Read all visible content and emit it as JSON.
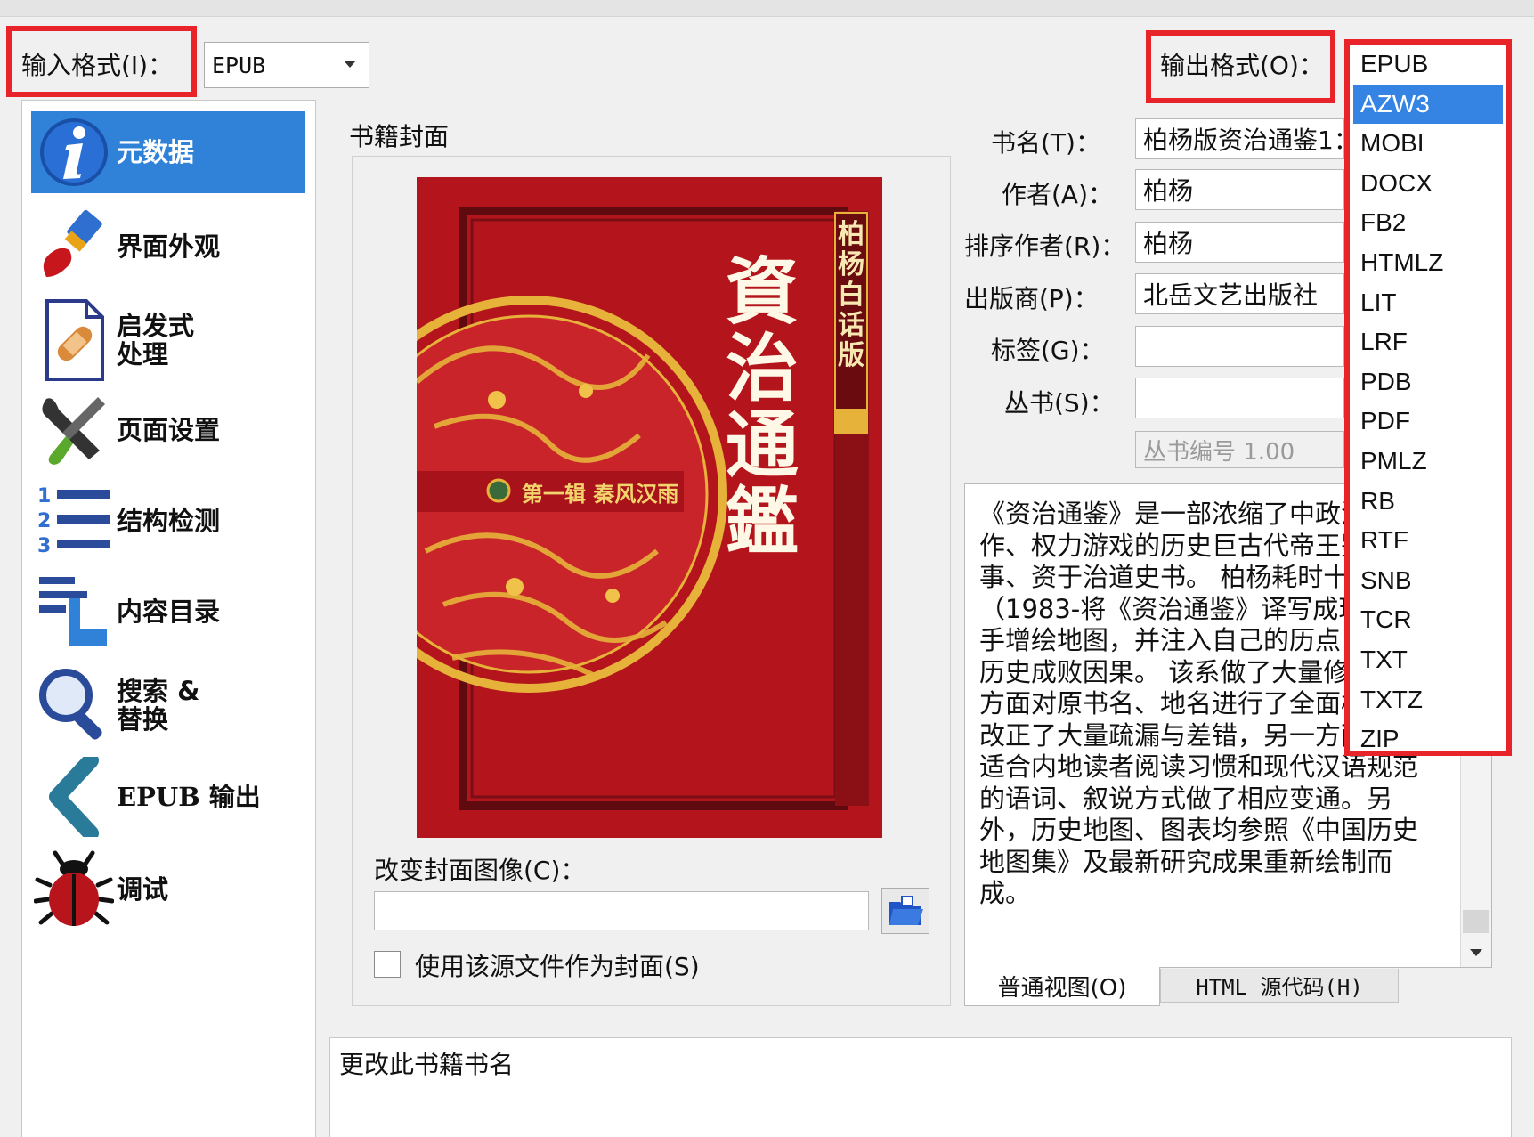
{
  "input_format": {
    "label": "输入格式(I)：",
    "value": "EPUB"
  },
  "output_format": {
    "label": "输出格式(O)：",
    "options": [
      "EPUB",
      "AZW3",
      "MOBI",
      "DOCX",
      "FB2",
      "HTMLZ",
      "LIT",
      "LRF",
      "PDB",
      "PDF",
      "PMLZ",
      "RB",
      "RTF",
      "SNB",
      "TCR",
      "TXT",
      "TXTZ",
      "ZIP"
    ],
    "selected": "AZW3"
  },
  "sidebar": {
    "items": [
      {
        "label": "元数据",
        "icon": "info-icon",
        "selected": true
      },
      {
        "label": "界面外观",
        "icon": "paintbrush-icon"
      },
      {
        "label": "启发式\n处理",
        "icon": "bandage-icon"
      },
      {
        "label": "页面设置",
        "icon": "tools-icon"
      },
      {
        "label": "结构检测",
        "icon": "numbered-list-icon"
      },
      {
        "label": "内容目录",
        "icon": "toc-icon"
      },
      {
        "label": "搜索 &\n替换",
        "icon": "magnifier-icon"
      },
      {
        "label": "EPUB 输出",
        "icon": "chevron-left-icon"
      },
      {
        "label": "调试",
        "icon": "bug-icon"
      }
    ]
  },
  "cover": {
    "group_label": "书籍封面",
    "title_chars": "資治通鑑",
    "edition": "柏杨白话版",
    "volume": "第一辑 秦风汉雨",
    "change_label": "改变封面图像(C)：",
    "path_value": "",
    "use_source_label": "使用该源文件作为封面(S)"
  },
  "metadata": {
    "title_label": "书名(T)：",
    "title_value": "柏杨版资治通鉴1：",
    "author_label": "作者(A)：",
    "author_value": "柏杨",
    "author_sort_label": "排序作者(R)：",
    "author_sort_value": "柏杨",
    "publisher_label": "出版商(P)：",
    "publisher_value": "北岳文艺出版社",
    "tags_label": "标签(G)：",
    "tags_value": "",
    "series_label": "丛书(S)：",
    "series_value": "",
    "series_number_placeholder": "丛书编号 1.00"
  },
  "comments": {
    "text": "《资治通鉴》是一部浓缩了中政治动作、权力游戏的历史巨古代帝王鉴于往事、资于治道史书。 柏杨耗时十年（1983-将《资治通鉴》译写成现代语手增绘地图，并注入自己的历点，谈论历史成败因果。 该系做了大量修订，一方面对原书名、地名进行了全面校订，改正了大量疏漏与差错，另一方面对不适合内地读者阅读习惯和现代汉语规范的语词、叙说方式做了相应变通。另外，历史地图、图表均参照《中国历史地图集》及最新研究成果重新绘制而成。",
    "tab_normal": "普通视图(O)",
    "tab_html": "HTML 源代码(H)"
  },
  "status_text": "更改此书籍书名",
  "colors": {
    "highlight_red": "#e8232a",
    "selection_blue": "#3584e4",
    "sidebar_selected": "#2f82d8",
    "cover_red": "#b4141b",
    "cover_gold": "#e6b23a"
  }
}
